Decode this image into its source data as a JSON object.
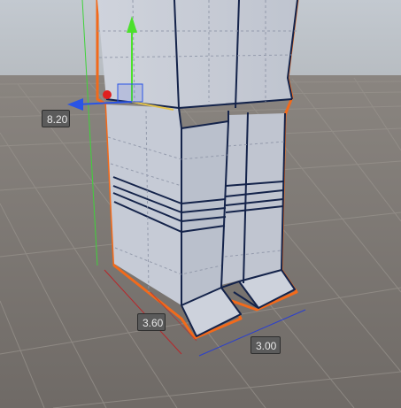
{
  "scene_view": {
    "dimensions": {
      "height": "8.20",
      "depth": "3.60",
      "width": "3.00"
    },
    "colors": {
      "background_sky": "#c7cdd4",
      "ground": "#7d7873",
      "grid_line": "#8c8782",
      "mesh_face": "#c9ced9",
      "mesh_edge": "#14234a",
      "selection_outline": "#f26a1b",
      "axis_x": "#e0201f",
      "axis_y": "#4ce02c",
      "axis_z": "#2a54e6",
      "bounds_x": "#b8262a",
      "bounds_y": "#3fd23a",
      "bounds_z": "#2a3fcf"
    },
    "gizmo": {
      "x_axis_icon": "x-axis-handle",
      "y_axis_icon": "y-axis-arrow",
      "z_axis_icon": "z-axis-arrow",
      "plane_icon": "xy-plane-handle"
    }
  }
}
